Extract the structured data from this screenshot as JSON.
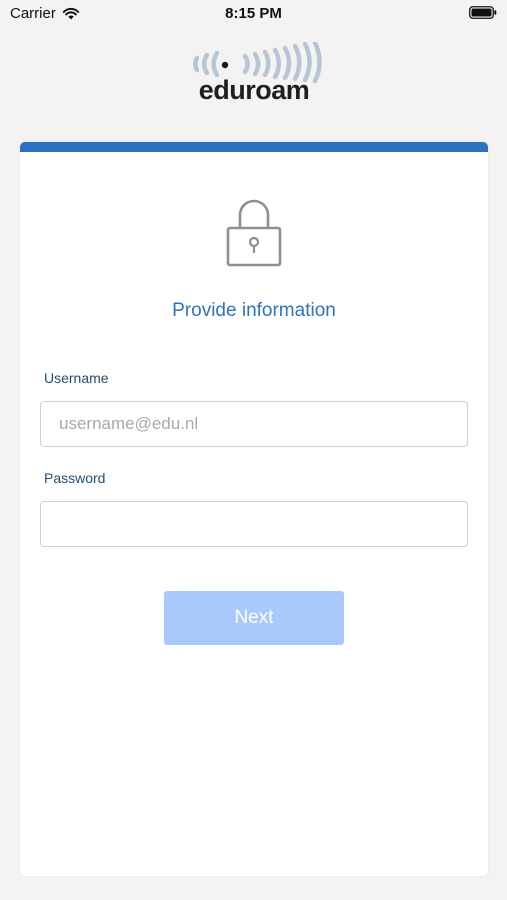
{
  "status_bar": {
    "carrier": "Carrier",
    "time": "8:15 PM",
    "wifi_icon": "wifi-icon",
    "battery_icon": "battery-icon"
  },
  "logo": {
    "text": "eduroam",
    "icon": "eduroam-logo"
  },
  "card": {
    "accent_color": "#2e6fc1",
    "icon": "lock-icon",
    "title": "Provide information"
  },
  "form": {
    "username_label": "Username",
    "username_placeholder": "username@edu.nl",
    "username_value": "",
    "password_label": "Password",
    "password_placeholder": "",
    "password_value": ""
  },
  "next_button": {
    "label": "Next",
    "enabled": false,
    "color": "#a9c8fb"
  }
}
